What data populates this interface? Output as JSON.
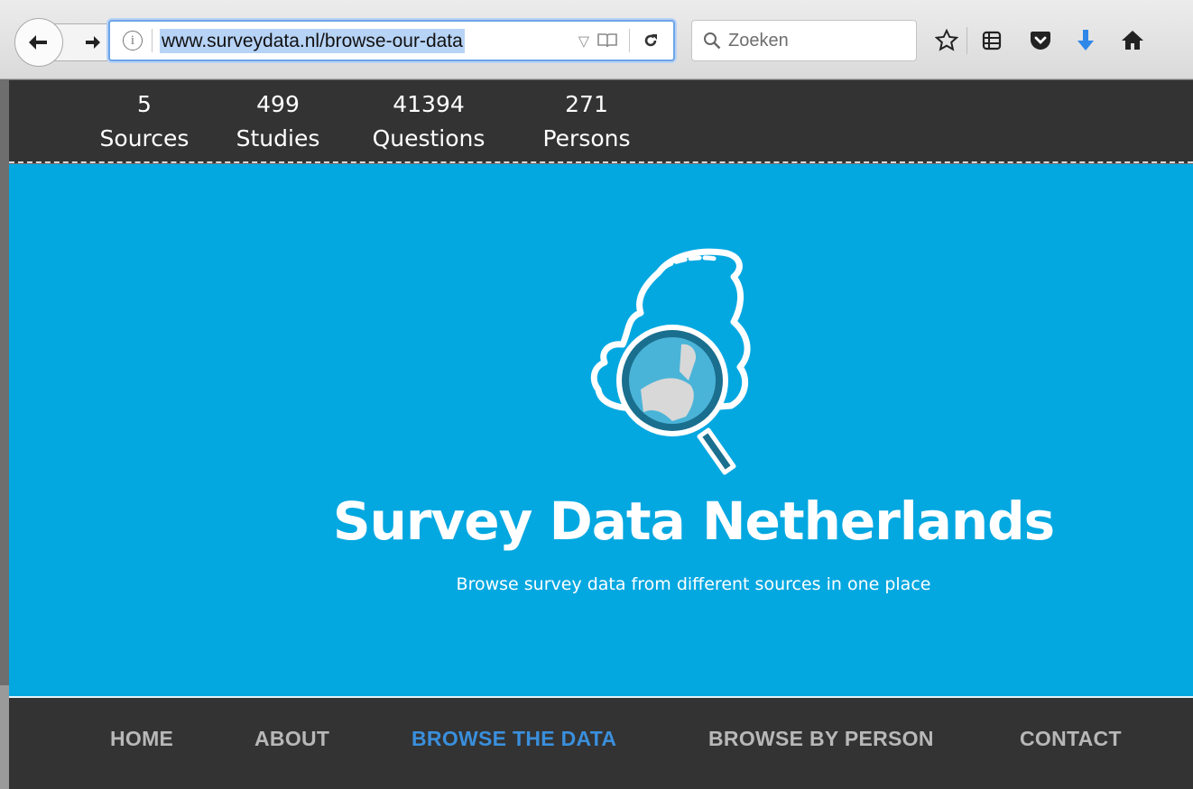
{
  "browser": {
    "url": "www.surveydata.nl/browse-our-data",
    "search_placeholder": "Zoeken"
  },
  "stats": [
    {
      "value": "5",
      "label": "Sources"
    },
    {
      "value": "499",
      "label": "Studies"
    },
    {
      "value": "41394",
      "label": "Questions"
    },
    {
      "value": "271",
      "label": "Persons"
    }
  ],
  "hero": {
    "title": "Survey Data Netherlands",
    "subtitle": "Browse survey data from different sources in one place"
  },
  "nav": {
    "home": "HOME",
    "about": "ABOUT",
    "browse_data": "BROWSE THE DATA",
    "browse_person": "BROWSE BY PERSON",
    "contact": "CONTACT",
    "active": "BROWSE THE DATA"
  },
  "colors": {
    "hero_bg": "#04a8e1",
    "bar_bg": "#333333",
    "active_link": "#3a8fdc",
    "download_arrow": "#2f87e8"
  }
}
